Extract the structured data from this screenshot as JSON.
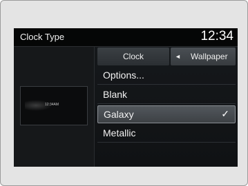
{
  "header": {
    "title": "Clock Type",
    "time": "12:34"
  },
  "preview": {
    "time": "12:34AM"
  },
  "tabs": [
    {
      "label": "Clock"
    },
    {
      "label": "Wallpaper",
      "arrow": "◄"
    }
  ],
  "menu": {
    "items": [
      {
        "label": "Options..."
      },
      {
        "label": "Blank"
      },
      {
        "label": "Galaxy",
        "selected": true,
        "check": "✓"
      },
      {
        "label": "Metallic"
      }
    ]
  },
  "colors": {
    "screen_bg": "#141618",
    "header_bg": "#050606",
    "selected_bg": "#52575c",
    "text": "#f2f2f2"
  }
}
